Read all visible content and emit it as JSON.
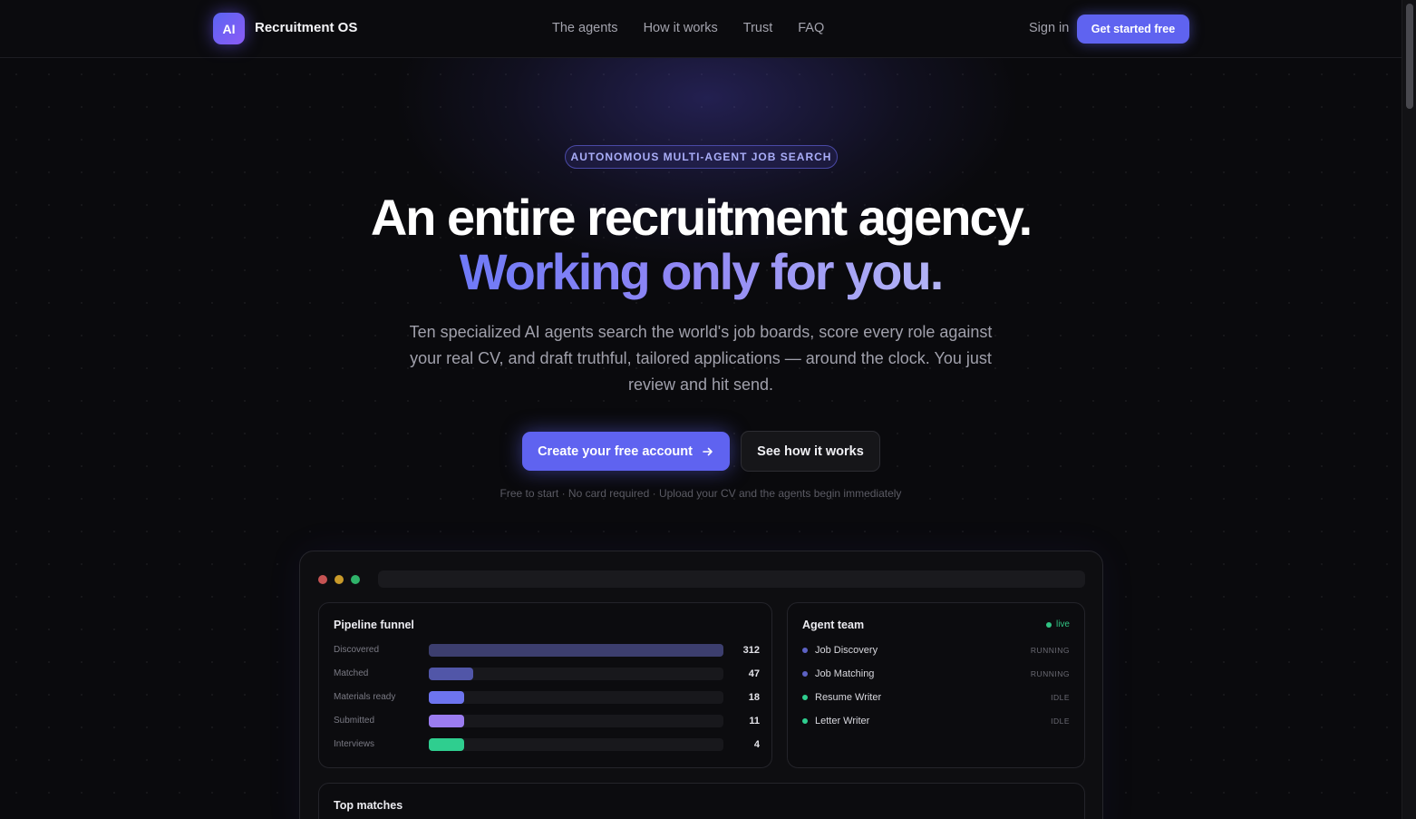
{
  "nav": {
    "logo_text": "AI",
    "brand": "Recruitment OS",
    "links": [
      "The agents",
      "How it works",
      "Trust",
      "FAQ"
    ],
    "sign_in": "Sign in",
    "cta": "Get started free"
  },
  "hero": {
    "pill": "AUTONOMOUS MULTI-AGENT JOB SEARCH",
    "headline_line1": "An entire recruitment agency.",
    "headline_line2": "Working only for you.",
    "subtitle": "Ten specialized AI agents search the world's job boards, score every role against your real CV, and draft truthful, tailored applications — around the clock. You just review and hit send.",
    "primary_button": "Create your free account",
    "primary_button_icon": "arrow-right-icon",
    "secondary_button": "See how it works",
    "fineprint": "Free to start · No card required · Upload your CV and the agents begin immediately"
  },
  "dashboard": {
    "funnel": {
      "title": "Pipeline funnel",
      "max": 312,
      "rows": [
        {
          "label": "Discovered",
          "value": 312,
          "color": "#3c3e6e"
        },
        {
          "label": "Matched",
          "value": 47,
          "color": "#5156a8"
        },
        {
          "label": "Materials ready",
          "value": 18,
          "color": "#6d74ef"
        },
        {
          "label": "Submitted",
          "value": 11,
          "color": "#9b7cf0"
        },
        {
          "label": "Interviews",
          "value": 4,
          "color": "#2fce8f"
        }
      ]
    },
    "agents": {
      "title": "Agent team",
      "live_label": "live",
      "rows": [
        {
          "name": "Job Discovery",
          "status": "RUNNING",
          "color": "#5d62c4"
        },
        {
          "name": "Job Matching",
          "status": "RUNNING",
          "color": "#5d62c4"
        },
        {
          "name": "Resume Writer",
          "status": "IDLE",
          "color": "#2fce8f"
        },
        {
          "name": "Letter Writer",
          "status": "IDLE",
          "color": "#2fce8f"
        }
      ]
    },
    "matches": {
      "title": "Top matches"
    }
  }
}
